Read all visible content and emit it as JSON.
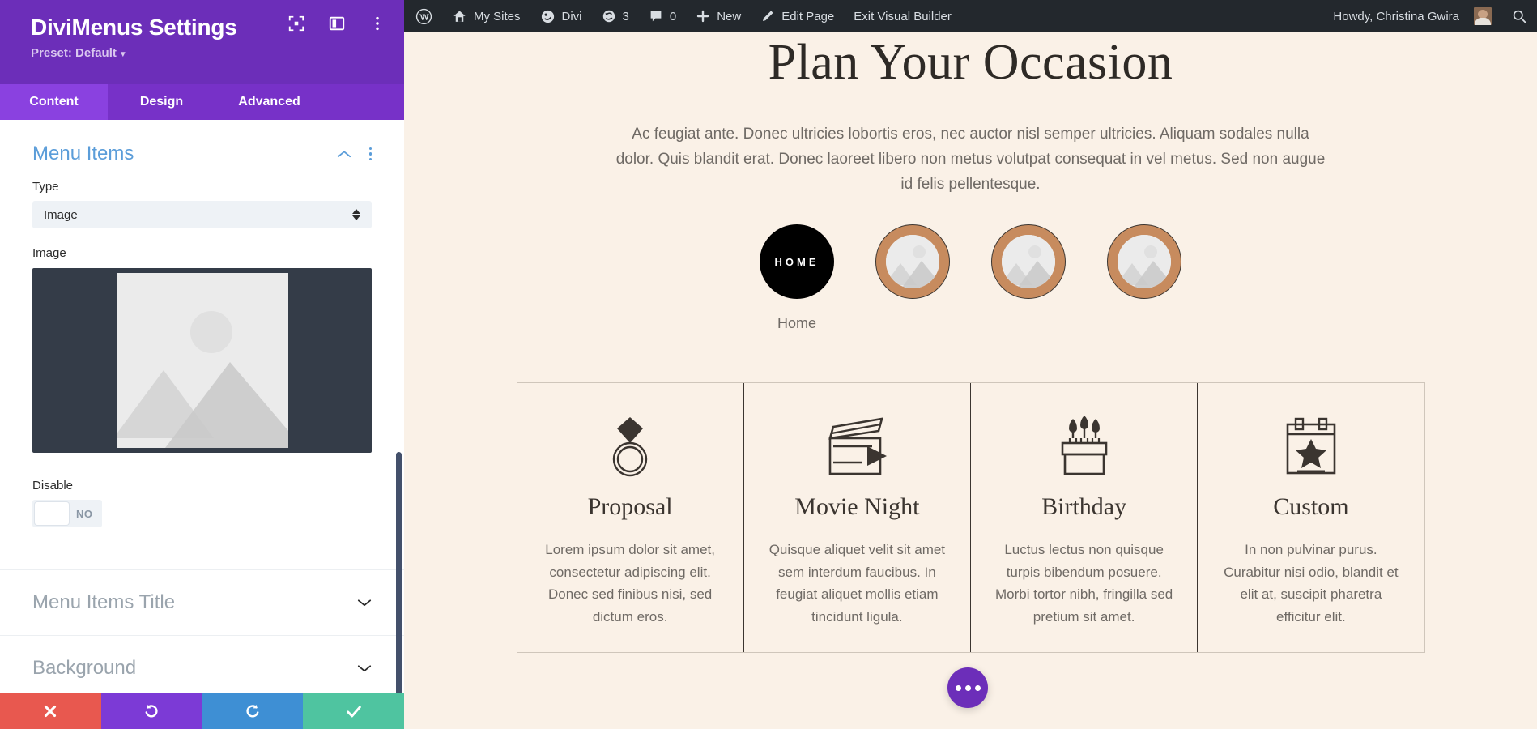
{
  "panel": {
    "title": "DiviMenus Settings",
    "preset_label": "Preset: Default",
    "header_icons": [
      "focus-target-icon",
      "layout-panel-icon",
      "vertical-dots-icon"
    ],
    "tabs": [
      {
        "label": "Content",
        "active": true
      },
      {
        "label": "Design",
        "active": false
      },
      {
        "label": "Advanced",
        "active": false
      }
    ],
    "sections": {
      "menu_items": {
        "title": "Menu Items",
        "expanded": true,
        "type_field": {
          "label": "Type",
          "value": "Image"
        },
        "image_field": {
          "label": "Image",
          "placeholder_icon": "image-placeholder-icon"
        },
        "disable_field": {
          "label": "Disable",
          "value": "NO",
          "on": false
        }
      },
      "collapsed": [
        {
          "title": "Menu Items Title"
        },
        {
          "title": "Background"
        }
      ]
    },
    "footer_buttons": [
      {
        "name": "cancel",
        "icon": "close-icon",
        "color": "#e8584f"
      },
      {
        "name": "undo",
        "icon": "undo-icon",
        "color": "#7c3ad6"
      },
      {
        "name": "redo",
        "icon": "redo-icon",
        "color": "#3e8fd4"
      },
      {
        "name": "save",
        "icon": "check-icon",
        "color": "#4fc4a0"
      }
    ]
  },
  "adminbar": {
    "items": [
      {
        "label": "",
        "icon": "wordpress-logo-icon"
      },
      {
        "label": "My Sites",
        "icon": "sites-icon"
      },
      {
        "label": "Divi",
        "icon": "divi-icon"
      },
      {
        "label": "3",
        "icon": "updates-icon"
      },
      {
        "label": "0",
        "icon": "comments-icon"
      },
      {
        "label": "New",
        "icon": "plus-icon"
      },
      {
        "label": "Edit Page",
        "icon": "pencil-icon"
      },
      {
        "label": "Exit Visual Builder",
        "icon": ""
      }
    ],
    "howdy": "Howdy, Christina Gwira",
    "search_icon": "search-icon"
  },
  "page": {
    "heading": "Plan Your Occasion",
    "subtext": "Ac feugiat ante. Donec ultricies lobortis eros, nec auctor nisl semper ultricies. Aliquam sodales nulla dolor. Quis blandit erat. Donec laoreet libero non metus volutpat consequat in vel metus. Sed non augue id felis pellentesque.",
    "circle_menu": [
      {
        "type": "text",
        "text": "HOME",
        "label": "Home"
      },
      {
        "type": "image",
        "text": "",
        "label": ""
      },
      {
        "type": "image",
        "text": "",
        "label": ""
      },
      {
        "type": "image",
        "text": "",
        "label": ""
      }
    ],
    "cards": [
      {
        "icon": "ring-icon",
        "title": "Proposal",
        "text": "Lorem ipsum dolor sit amet, consectetur adipiscing elit. Donec sed finibus nisi, sed dictum eros."
      },
      {
        "icon": "clapperboard-icon",
        "title": "Movie Night",
        "text": "Quisque aliquet velit sit amet sem interdum faucibus. In feugiat aliquet mollis etiam tincidunt ligula."
      },
      {
        "icon": "birthday-cake-icon",
        "title": "Birthday",
        "text": "Luctus lectus non quisque turpis bibendum posuere. Morbi tortor nibh, fringilla sed pretium sit amet."
      },
      {
        "icon": "calendar-star-icon",
        "title": "Custom",
        "text": "In non pulvinar purus. Curabitur nisi odio, blandit et elit at, suscipit pharetra efficitur elit."
      }
    ],
    "fab_icon": "horizontal-dots-icon"
  },
  "colors": {
    "panel_purple": "#6c2eb9",
    "tab_active": "#8a41e0",
    "section_blue": "#5b9dd9",
    "page_bg": "#faf1e7",
    "accent_tan": "#c78b5e",
    "ink": "#3b3530"
  }
}
